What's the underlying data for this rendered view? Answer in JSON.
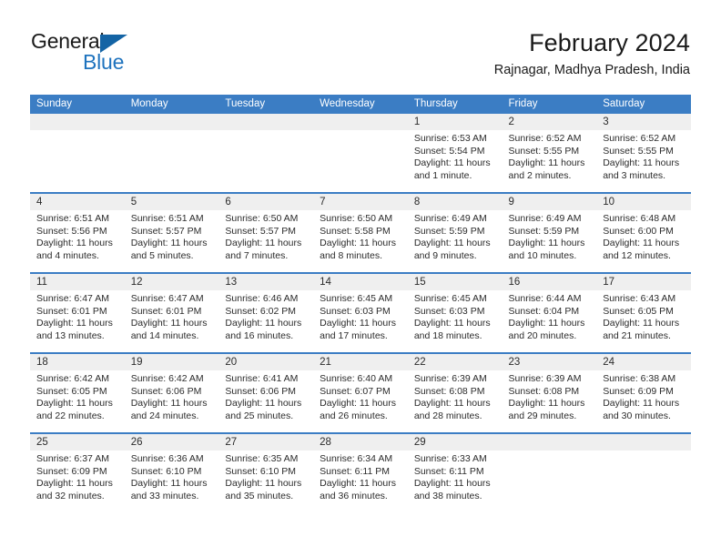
{
  "brand": {
    "name_part1": "General",
    "name_part2": "Blue",
    "icon": "triangle-flag-icon"
  },
  "header": {
    "title": "February 2024",
    "subtitle": "Rajnagar, Madhya Pradesh, India"
  },
  "colors": {
    "header_blue": "#3b7dc4",
    "brand_blue": "#1e73be",
    "daynum_band": "#efefef",
    "text": "#2b2b2b"
  },
  "calendar": {
    "weekdays": [
      "Sunday",
      "Monday",
      "Tuesday",
      "Wednesday",
      "Thursday",
      "Friday",
      "Saturday"
    ],
    "weeks": [
      [
        {
          "day": "",
          "lines": []
        },
        {
          "day": "",
          "lines": []
        },
        {
          "day": "",
          "lines": []
        },
        {
          "day": "",
          "lines": []
        },
        {
          "day": "1",
          "lines": [
            "Sunrise: 6:53 AM",
            "Sunset: 5:54 PM",
            "Daylight: 11 hours and 1 minute."
          ]
        },
        {
          "day": "2",
          "lines": [
            "Sunrise: 6:52 AM",
            "Sunset: 5:55 PM",
            "Daylight: 11 hours and 2 minutes."
          ]
        },
        {
          "day": "3",
          "lines": [
            "Sunrise: 6:52 AM",
            "Sunset: 5:55 PM",
            "Daylight: 11 hours and 3 minutes."
          ]
        }
      ],
      [
        {
          "day": "4",
          "lines": [
            "Sunrise: 6:51 AM",
            "Sunset: 5:56 PM",
            "Daylight: 11 hours and 4 minutes."
          ]
        },
        {
          "day": "5",
          "lines": [
            "Sunrise: 6:51 AM",
            "Sunset: 5:57 PM",
            "Daylight: 11 hours and 5 minutes."
          ]
        },
        {
          "day": "6",
          "lines": [
            "Sunrise: 6:50 AM",
            "Sunset: 5:57 PM",
            "Daylight: 11 hours and 7 minutes."
          ]
        },
        {
          "day": "7",
          "lines": [
            "Sunrise: 6:50 AM",
            "Sunset: 5:58 PM",
            "Daylight: 11 hours and 8 minutes."
          ]
        },
        {
          "day": "8",
          "lines": [
            "Sunrise: 6:49 AM",
            "Sunset: 5:59 PM",
            "Daylight: 11 hours and 9 minutes."
          ]
        },
        {
          "day": "9",
          "lines": [
            "Sunrise: 6:49 AM",
            "Sunset: 5:59 PM",
            "Daylight: 11 hours and 10 minutes."
          ]
        },
        {
          "day": "10",
          "lines": [
            "Sunrise: 6:48 AM",
            "Sunset: 6:00 PM",
            "Daylight: 11 hours and 12 minutes."
          ]
        }
      ],
      [
        {
          "day": "11",
          "lines": [
            "Sunrise: 6:47 AM",
            "Sunset: 6:01 PM",
            "Daylight: 11 hours and 13 minutes."
          ]
        },
        {
          "day": "12",
          "lines": [
            "Sunrise: 6:47 AM",
            "Sunset: 6:01 PM",
            "Daylight: 11 hours and 14 minutes."
          ]
        },
        {
          "day": "13",
          "lines": [
            "Sunrise: 6:46 AM",
            "Sunset: 6:02 PM",
            "Daylight: 11 hours and 16 minutes."
          ]
        },
        {
          "day": "14",
          "lines": [
            "Sunrise: 6:45 AM",
            "Sunset: 6:03 PM",
            "Daylight: 11 hours and 17 minutes."
          ]
        },
        {
          "day": "15",
          "lines": [
            "Sunrise: 6:45 AM",
            "Sunset: 6:03 PM",
            "Daylight: 11 hours and 18 minutes."
          ]
        },
        {
          "day": "16",
          "lines": [
            "Sunrise: 6:44 AM",
            "Sunset: 6:04 PM",
            "Daylight: 11 hours and 20 minutes."
          ]
        },
        {
          "day": "17",
          "lines": [
            "Sunrise: 6:43 AM",
            "Sunset: 6:05 PM",
            "Daylight: 11 hours and 21 minutes."
          ]
        }
      ],
      [
        {
          "day": "18",
          "lines": [
            "Sunrise: 6:42 AM",
            "Sunset: 6:05 PM",
            "Daylight: 11 hours and 22 minutes."
          ]
        },
        {
          "day": "19",
          "lines": [
            "Sunrise: 6:42 AM",
            "Sunset: 6:06 PM",
            "Daylight: 11 hours and 24 minutes."
          ]
        },
        {
          "day": "20",
          "lines": [
            "Sunrise: 6:41 AM",
            "Sunset: 6:06 PM",
            "Daylight: 11 hours and 25 minutes."
          ]
        },
        {
          "day": "21",
          "lines": [
            "Sunrise: 6:40 AM",
            "Sunset: 6:07 PM",
            "Daylight: 11 hours and 26 minutes."
          ]
        },
        {
          "day": "22",
          "lines": [
            "Sunrise: 6:39 AM",
            "Sunset: 6:08 PM",
            "Daylight: 11 hours and 28 minutes."
          ]
        },
        {
          "day": "23",
          "lines": [
            "Sunrise: 6:39 AM",
            "Sunset: 6:08 PM",
            "Daylight: 11 hours and 29 minutes."
          ]
        },
        {
          "day": "24",
          "lines": [
            "Sunrise: 6:38 AM",
            "Sunset: 6:09 PM",
            "Daylight: 11 hours and 30 minutes."
          ]
        }
      ],
      [
        {
          "day": "25",
          "lines": [
            "Sunrise: 6:37 AM",
            "Sunset: 6:09 PM",
            "Daylight: 11 hours and 32 minutes."
          ]
        },
        {
          "day": "26",
          "lines": [
            "Sunrise: 6:36 AM",
            "Sunset: 6:10 PM",
            "Daylight: 11 hours and 33 minutes."
          ]
        },
        {
          "day": "27",
          "lines": [
            "Sunrise: 6:35 AM",
            "Sunset: 6:10 PM",
            "Daylight: 11 hours and 35 minutes."
          ]
        },
        {
          "day": "28",
          "lines": [
            "Sunrise: 6:34 AM",
            "Sunset: 6:11 PM",
            "Daylight: 11 hours and 36 minutes."
          ]
        },
        {
          "day": "29",
          "lines": [
            "Sunrise: 6:33 AM",
            "Sunset: 6:11 PM",
            "Daylight: 11 hours and 38 minutes."
          ]
        },
        {
          "day": "",
          "lines": []
        },
        {
          "day": "",
          "lines": []
        }
      ]
    ]
  }
}
